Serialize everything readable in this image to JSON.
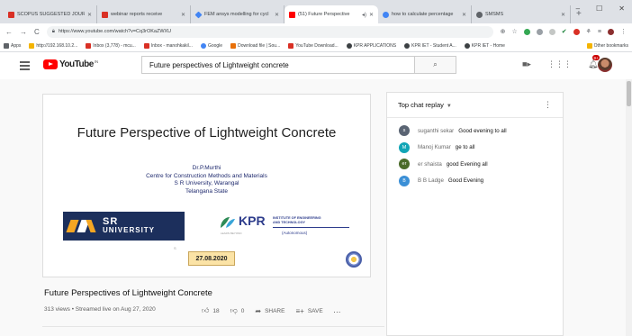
{
  "browser": {
    "tabs": [
      {
        "title": "SCOPUS SUGGESTED JOURN",
        "color": "#d93025",
        "active": false
      },
      {
        "title": "webinar reports receive",
        "color": "#d93025",
        "active": false
      },
      {
        "title": "FEM ansys modelling for cycl",
        "color": "#4285f4",
        "active": false
      },
      {
        "title": "(51) Future Perspective",
        "color": "#ff0000",
        "active": true
      },
      {
        "title": "how to calculate percentage",
        "color": "#4285f4",
        "active": false
      },
      {
        "title": "SMSMS",
        "color": "#5f6368",
        "active": false
      }
    ],
    "window_controls": [
      "–",
      "☐",
      "✕"
    ],
    "url": "https://www.youtube.com/watch?v=Cq3rOKaZWXU",
    "bookmarks": [
      {
        "label": "Apps",
        "color": "#5f6368"
      },
      {
        "label": "http://192.168.10.2...",
        "color": "#f4b400"
      },
      {
        "label": "Inbox (3,778) - mcu...",
        "color": "#d93025"
      },
      {
        "label": "Inbox - manohkakil...",
        "color": "#d93025"
      },
      {
        "label": "Google",
        "color": "#4285f4"
      },
      {
        "label": "Download file | Sou...",
        "color": "#e8710a"
      },
      {
        "label": "YouTube Download...",
        "color": "#d93025"
      },
      {
        "label": "KPR APPLICATIONS",
        "color": "#3c4043"
      },
      {
        "label": "KPR IET - Student A...",
        "color": "#3c4043"
      },
      {
        "label": "KPR IET - Home",
        "color": "#3c4043"
      }
    ],
    "other_bookmarks": "Other bookmarks"
  },
  "youtube": {
    "logo_text": "YouTube",
    "logo_region": "IN",
    "search_value": "Future perspectives of Lightweight concrete",
    "notification_count": "9+",
    "video": {
      "slide_title": "Future Perspective of Lightweight Concrete",
      "presenter": "Dr.P.Murthi",
      "presenter_dept": "Centre for Construction Methods and Materials",
      "presenter_univ": "S R University, Warangal",
      "presenter_state": "Telangana State",
      "sr_logo_line1": "SR",
      "sr_logo_line2": "UNIVERSITY",
      "kpr_logo": "KPR",
      "kpr_inst_line1": "INSTITUTE OF ENGINEERING",
      "kpr_inst_line2": "AND TECHNOLOGY",
      "kpr_sub": "(Autonomous)",
      "kpr_tagline": "LEARN BEYOND",
      "tiny_mark": "S",
      "date": "27.08.2020"
    },
    "title": "Future Perspectives of Lightweight Concrete",
    "meta": "313 views • Streamed live on Aug 27, 2020",
    "likes": "18",
    "dislikes": "0",
    "share_label": "SHARE",
    "save_label": "SAVE",
    "more_label": "...",
    "chat": {
      "header": "Top chat replay",
      "messages": [
        {
          "initial": "s",
          "color": "#5a6473",
          "author": "suganthi sekar",
          "text": "Good evening to all"
        },
        {
          "initial": "M",
          "color": "#12a5b6",
          "author": "Manoj Kumar",
          "text": "ge to all"
        },
        {
          "initial": "er",
          "color": "#4b6b2a",
          "author": "er shaista",
          "text": "good Evening all"
        },
        {
          "initial": "B",
          "color": "#3b8fd6",
          "author": "B B Ladge",
          "text": "Good Evening"
        }
      ]
    }
  }
}
